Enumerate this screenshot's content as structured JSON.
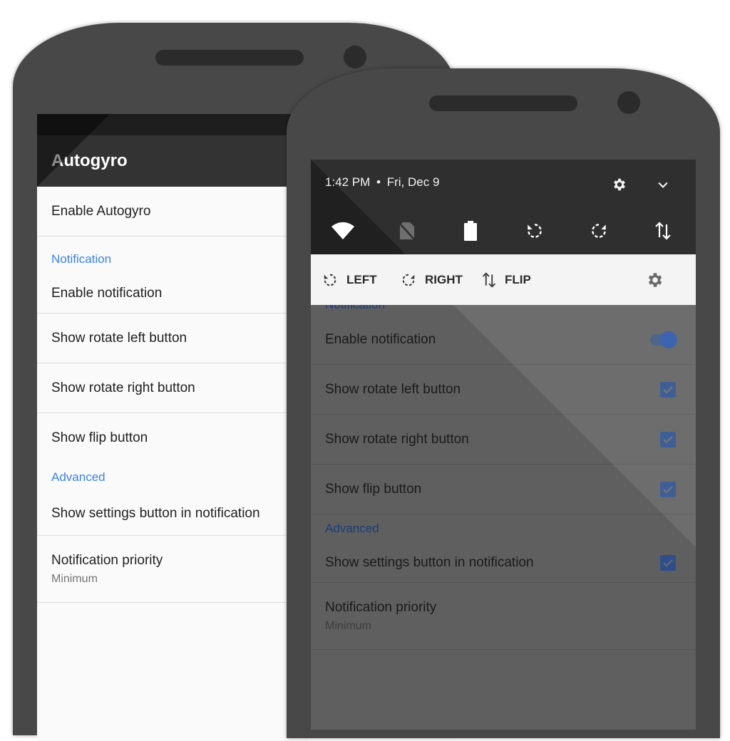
{
  "back_screen": {
    "app_title": "Autogyro",
    "prefs": {
      "enable": "Enable Autogyro",
      "cat_notification": "Notification",
      "enable_notification": "Enable notification",
      "show_left": "Show rotate left button",
      "show_right": "Show rotate right button",
      "show_flip": "Show flip button",
      "cat_advanced": "Advanced",
      "show_settings": "Show settings button in notification",
      "priority": "Notification priority",
      "priority_value": "Minimum"
    }
  },
  "front_screen": {
    "quick_settings": {
      "time": "1:42 PM",
      "separator": "•",
      "date": "Fri, Dec 9",
      "icons": [
        "wifi-icon",
        "no-sim-icon",
        "battery-icon",
        "rotate-left-icon",
        "rotate-right-icon",
        "data-transfer-icon"
      ]
    },
    "notification": {
      "left_label": "LEFT",
      "right_label": "RIGHT",
      "flip_label": "FLIP"
    },
    "prefs": {
      "cat_notification": "Notification",
      "enable_notification": "Enable notification",
      "show_left": "Show rotate left button",
      "show_right": "Show rotate right button",
      "show_flip": "Show flip button",
      "cat_advanced": "Advanced",
      "show_settings": "Show settings button in notification",
      "priority": "Notification priority",
      "priority_value": "Minimum"
    },
    "states": {
      "enable_notification": true,
      "show_left": true,
      "show_right": true,
      "show_flip": true,
      "show_settings": true
    }
  },
  "colors": {
    "accent": "#3b82e8",
    "phone_body": "#484848",
    "app_bar": "#333333"
  }
}
